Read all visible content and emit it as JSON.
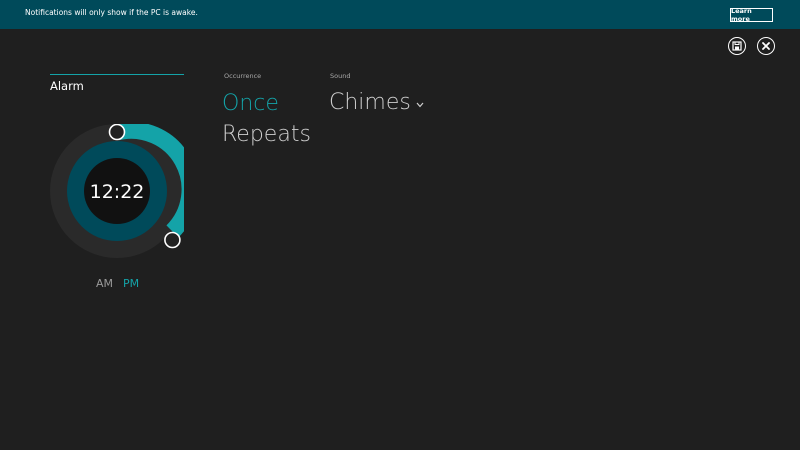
{
  "notification": {
    "text": "Notifications will only show if the PC is awake.",
    "learn_more": "Learn more"
  },
  "toolbar": {
    "save_icon": "save-icon",
    "close_icon": "close-icon"
  },
  "alarm": {
    "title": "Alarm",
    "time": "12:22",
    "am_label": "AM",
    "pm_label": "PM",
    "selected_period": "PM",
    "accent_color": "#14a3a8"
  },
  "occurrence": {
    "label": "Occurrence",
    "options": [
      "Once",
      "Repeats"
    ],
    "selected": "Once"
  },
  "sound": {
    "label": "Sound",
    "value": "Chimes"
  }
}
